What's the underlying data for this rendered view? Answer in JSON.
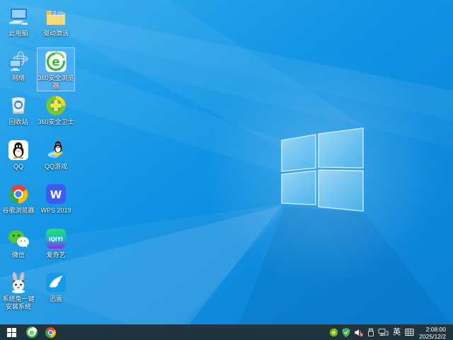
{
  "colors": {
    "wallpaper_base": "#0f8fe0",
    "wallpaper_light": "#3db4f2",
    "taskbar_bg": "#203340",
    "selection": "#7ab8e8",
    "label_text": "#ffffff"
  },
  "desktop": {
    "icons": [
      {
        "label": "此电脑",
        "icon": "computer-icon",
        "selected": false
      },
      {
        "label": "网络",
        "icon": "network-icon",
        "selected": false
      },
      {
        "label": "回收站",
        "icon": "recycle-bin-icon",
        "selected": false
      },
      {
        "label": "QQ",
        "icon": "qq-icon",
        "selected": false
      },
      {
        "label": "谷歌浏览器",
        "icon": "chrome-icon",
        "selected": false
      },
      {
        "label": "微信",
        "icon": "wechat-icon",
        "selected": false
      },
      {
        "label": "系统兔一键安装系统",
        "icon": "system-rabbit-icon",
        "selected": false
      },
      {
        "label": "驱动激活",
        "icon": "folder-icon",
        "selected": false
      },
      {
        "label": "360安全浏览器",
        "icon": "browser-360-icon",
        "icon_text": "e",
        "selected": true
      },
      {
        "label": "360安全卫士",
        "icon": "safety-guard-icon",
        "selected": false
      },
      {
        "label": "QQ游戏",
        "icon": "qq-games-icon",
        "selected": false
      },
      {
        "label": "WPS 2019",
        "icon": "wps-icon",
        "icon_text": "W",
        "selected": false
      },
      {
        "label": "爱奇艺",
        "icon": "iqiyi-icon",
        "icon_text": "iQIYI",
        "selected": false
      },
      {
        "label": "迅雷",
        "icon": "thunder-icon",
        "selected": false
      }
    ]
  },
  "taskbar": {
    "start_button": "start-button",
    "pinned": [
      {
        "icon": "browser-360-taskbar-icon",
        "icon_text": "e"
      },
      {
        "icon": "chrome-taskbar-icon"
      }
    ],
    "tray": {
      "icons": [
        "360-safety-tray-icon",
        "shield-tray-icon",
        "volume-muted-icon",
        "usb-device-icon",
        "network-tray-icon",
        "ime-indicator",
        "keyboard-layout-icon"
      ],
      "ime_label": "英",
      "clock_time": "2:08:00",
      "clock_date": "2025/12/2"
    }
  }
}
